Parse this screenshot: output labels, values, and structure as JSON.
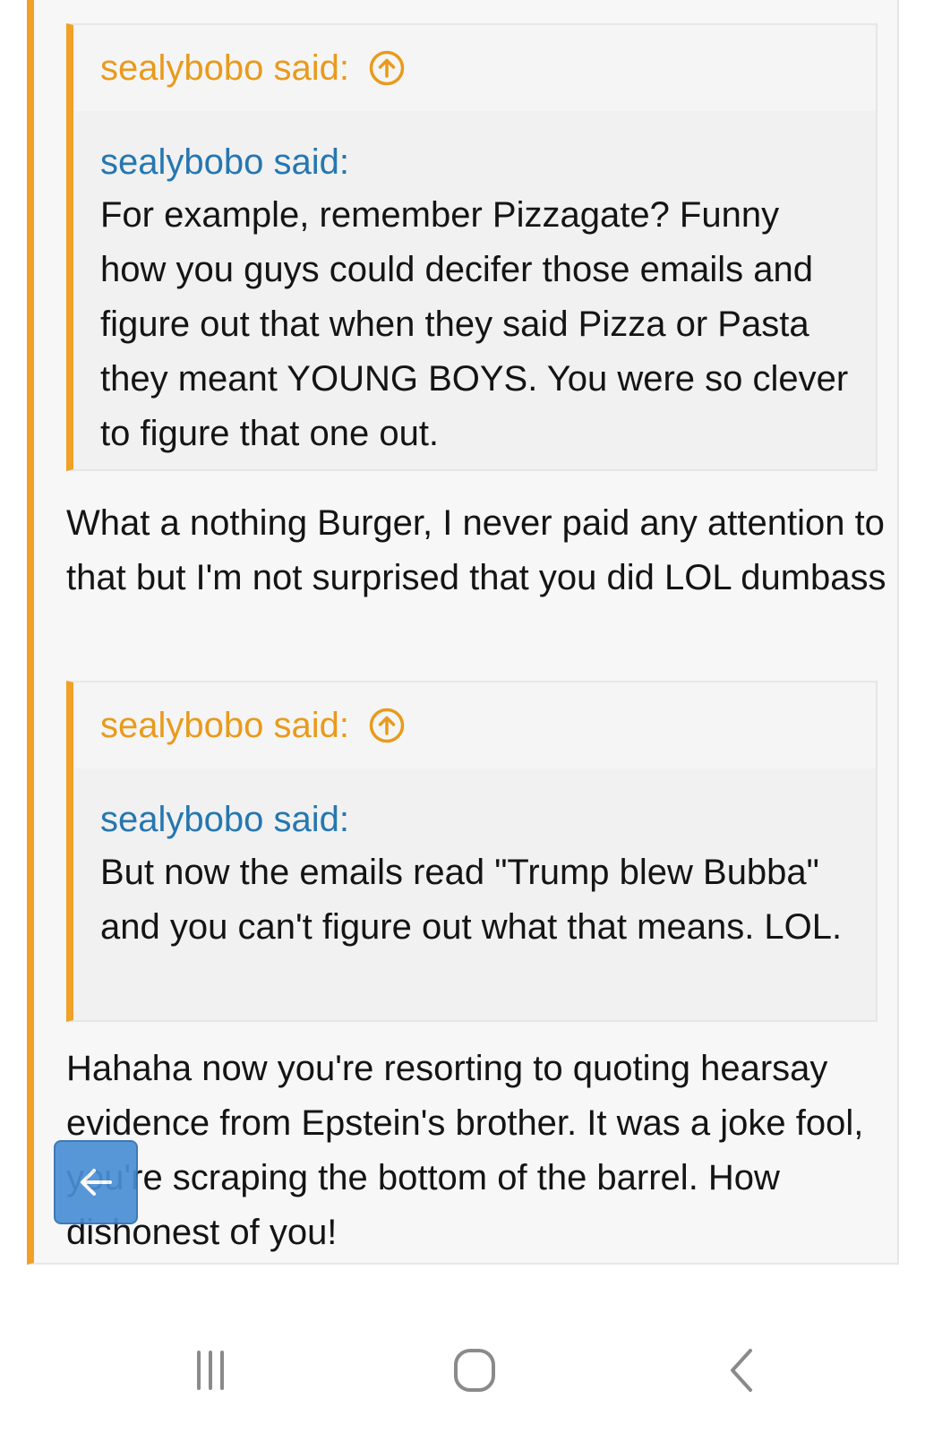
{
  "post": {
    "accent_color": "#f1a126",
    "quotes": [
      {
        "author": "sealybobo said:",
        "nested_author": "sealybobo said:",
        "text": "For example, remember Pizzagate? Funny how you guys could decifer those emails and figure out that when they said Pizza or Pasta they meant YOUNG BOYS. You were so clever to figure that one out."
      },
      {
        "author": "sealybobo said:",
        "nested_author": "sealybobo said:",
        "text": "But now the emails read \"Trump blew Bubba\" and you can't figure out what that means. LOL."
      }
    ],
    "replies": [
      "What a nothing Burger, I never paid any attention to that but I'm not surprised that you did LOL dumbass",
      "Hahaha now you're resorting to quoting hearsay evidence from Epstein's brother. It was a joke fool, you're scraping the bottom of the barrel. How dishonest of you!"
    ]
  },
  "icons": {
    "quote_jump": "arrow-up-circle-icon",
    "floating_back": "arrow-left-icon",
    "nav_recents": "recents-icon",
    "nav_home": "home-icon",
    "nav_back": "back-chevron-icon"
  },
  "colors": {
    "quote_author": "#e99a1c",
    "nested_author": "#2577b1",
    "fab": "#4a8fd6"
  }
}
